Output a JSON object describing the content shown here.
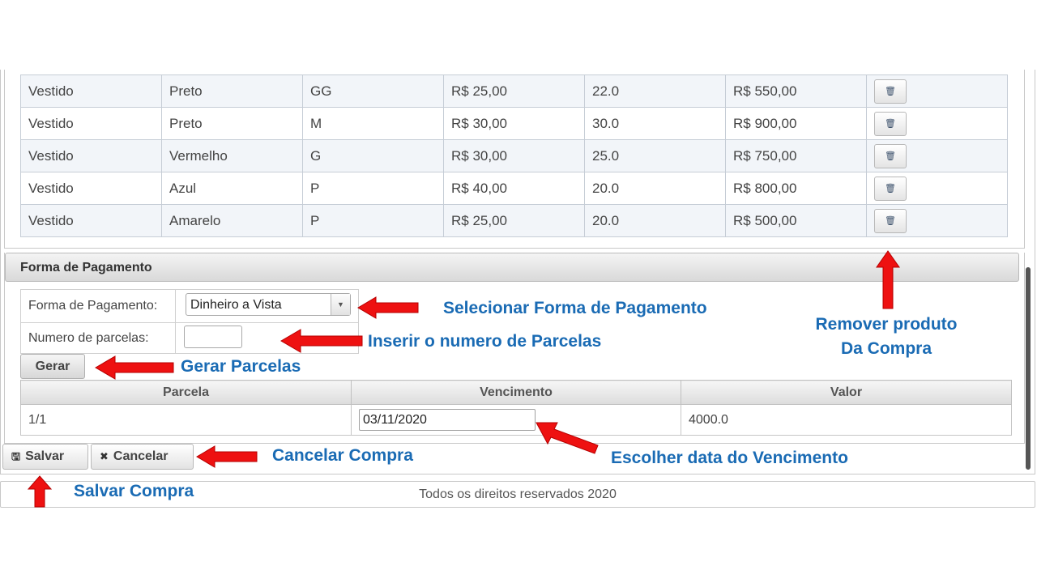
{
  "products": {
    "rows": [
      {
        "name": "Vestido",
        "color": "Preto",
        "size": "GG",
        "price": "R$ 25,00",
        "qty": "22.0",
        "total": "R$ 550,00"
      },
      {
        "name": "Vestido",
        "color": "Preto",
        "size": "M",
        "price": "R$ 30,00",
        "qty": "30.0",
        "total": "R$ 900,00"
      },
      {
        "name": "Vestido",
        "color": "Vermelho",
        "size": "G",
        "price": "R$ 30,00",
        "qty": "25.0",
        "total": "R$ 750,00"
      },
      {
        "name": "Vestido",
        "color": "Azul",
        "size": "P",
        "price": "R$ 40,00",
        "qty": "20.0",
        "total": "R$ 800,00"
      },
      {
        "name": "Vestido",
        "color": "Amarelo",
        "size": "P",
        "price": "R$ 25,00",
        "qty": "20.0",
        "total": "R$ 500,00"
      }
    ],
    "remove_icon": "trash-icon"
  },
  "payment": {
    "header": "Forma de Pagamento",
    "method_label": "Forma de Pagamento:",
    "method_value": "Dinheiro a Vista",
    "installments_label": "Numero de parcelas:",
    "installments_value": "",
    "generate_button": "Gerar"
  },
  "installments_table": {
    "columns": [
      "Parcela",
      "Vencimento",
      "Valor"
    ],
    "rows": [
      {
        "parcela": "1/1",
        "vencimento": "03/11/2020",
        "valor": "4000.0"
      }
    ]
  },
  "actions": {
    "save_label": "Salvar",
    "cancel_label": "Cancelar"
  },
  "footer": {
    "text": "Todos os direitos reservados 2020"
  },
  "annotations": {
    "select_method": "Selecionar Forma de Pagamento",
    "insert_installments": "Inserir o numero de Parcelas",
    "generate": "Gerar Parcelas",
    "remove_line1": "Remover produto",
    "remove_line2": "Da Compra",
    "choose_date": "Escolher data do Vencimento",
    "cancel": "Cancelar Compra",
    "save": "Salvar Compra"
  },
  "colors": {
    "annotation_text": "#1a6bb4",
    "arrow_red": "#ee1111"
  }
}
